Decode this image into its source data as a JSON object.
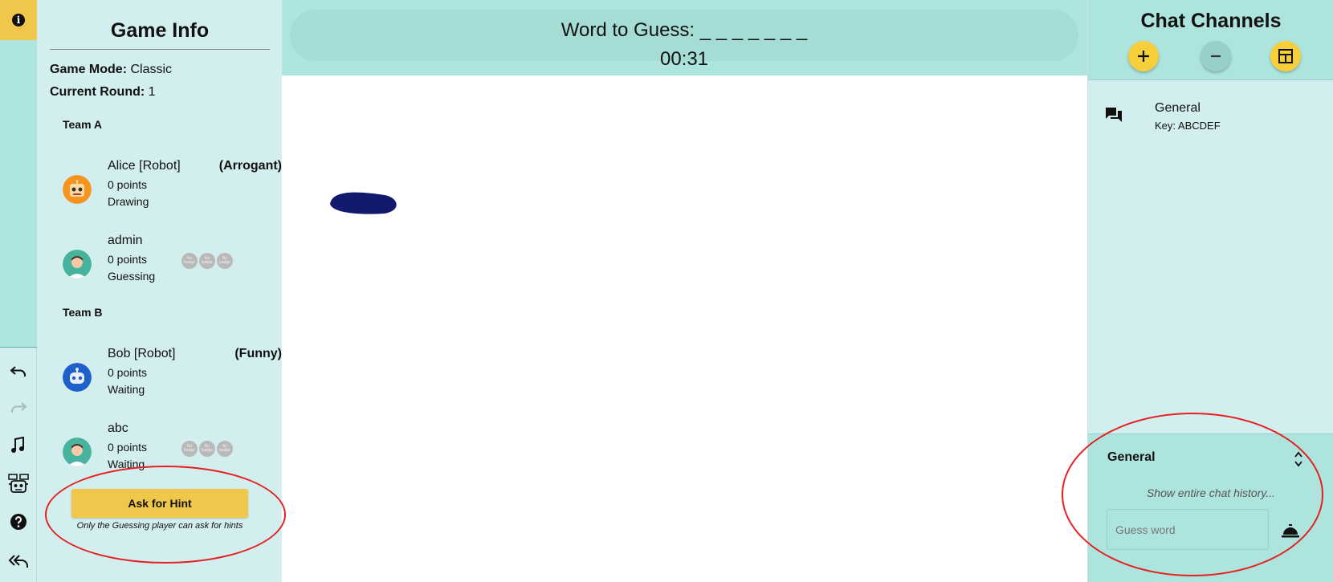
{
  "toolbar": {
    "info_icon": "info-icon",
    "tools": [
      "undo-icon",
      "redo-icon",
      "music-note-icon",
      "robot-icon",
      "help-icon",
      "reply-all-icon"
    ]
  },
  "game_info": {
    "title": "Game Info",
    "game_mode_label": "Game Mode:",
    "game_mode": "Classic",
    "round_label": "Current Round:",
    "round": "1",
    "teams": [
      {
        "name": "Team A",
        "players": [
          {
            "name": "Alice [Robot]",
            "persona": "(Arrogant)",
            "points": "0 points",
            "status": "Drawing",
            "badges": []
          },
          {
            "name": "admin",
            "persona": "",
            "points": "0 points",
            "status": "Guessing",
            "badges": [
              "No badge",
              "No badge",
              "No badge"
            ]
          }
        ]
      },
      {
        "name": "Team B",
        "players": [
          {
            "name": "Bob [Robot]",
            "persona": "(Funny)",
            "points": "0 points",
            "status": "Waiting",
            "badges": []
          },
          {
            "name": "abc",
            "persona": "",
            "points": "0 points",
            "status": "Waiting",
            "badges": [
              "No badge",
              "No badge",
              "No badge"
            ]
          }
        ]
      }
    ],
    "hint_button": "Ask for Hint",
    "hint_note": "Only the Guessing player can ask for hints"
  },
  "header": {
    "word_label": "Word to Guess: _ _ _ _ _ _ _",
    "timer": "00:31"
  },
  "chat": {
    "title": "Chat Channels",
    "buttons": [
      "add-icon",
      "remove-icon",
      "layout-icon"
    ],
    "channels": [
      {
        "name": "General",
        "key": "Key: ABCDEF"
      }
    ],
    "active_channel": "General",
    "history_link": "Show entire chat history...",
    "input_placeholder": "Guess word"
  },
  "colors": {
    "accent_yellow": "#efc74a",
    "teal_dark": "#aee4de",
    "teal_light": "#d3eeee",
    "stroke_navy": "#131a6e",
    "annotation_red": "#e52020"
  }
}
